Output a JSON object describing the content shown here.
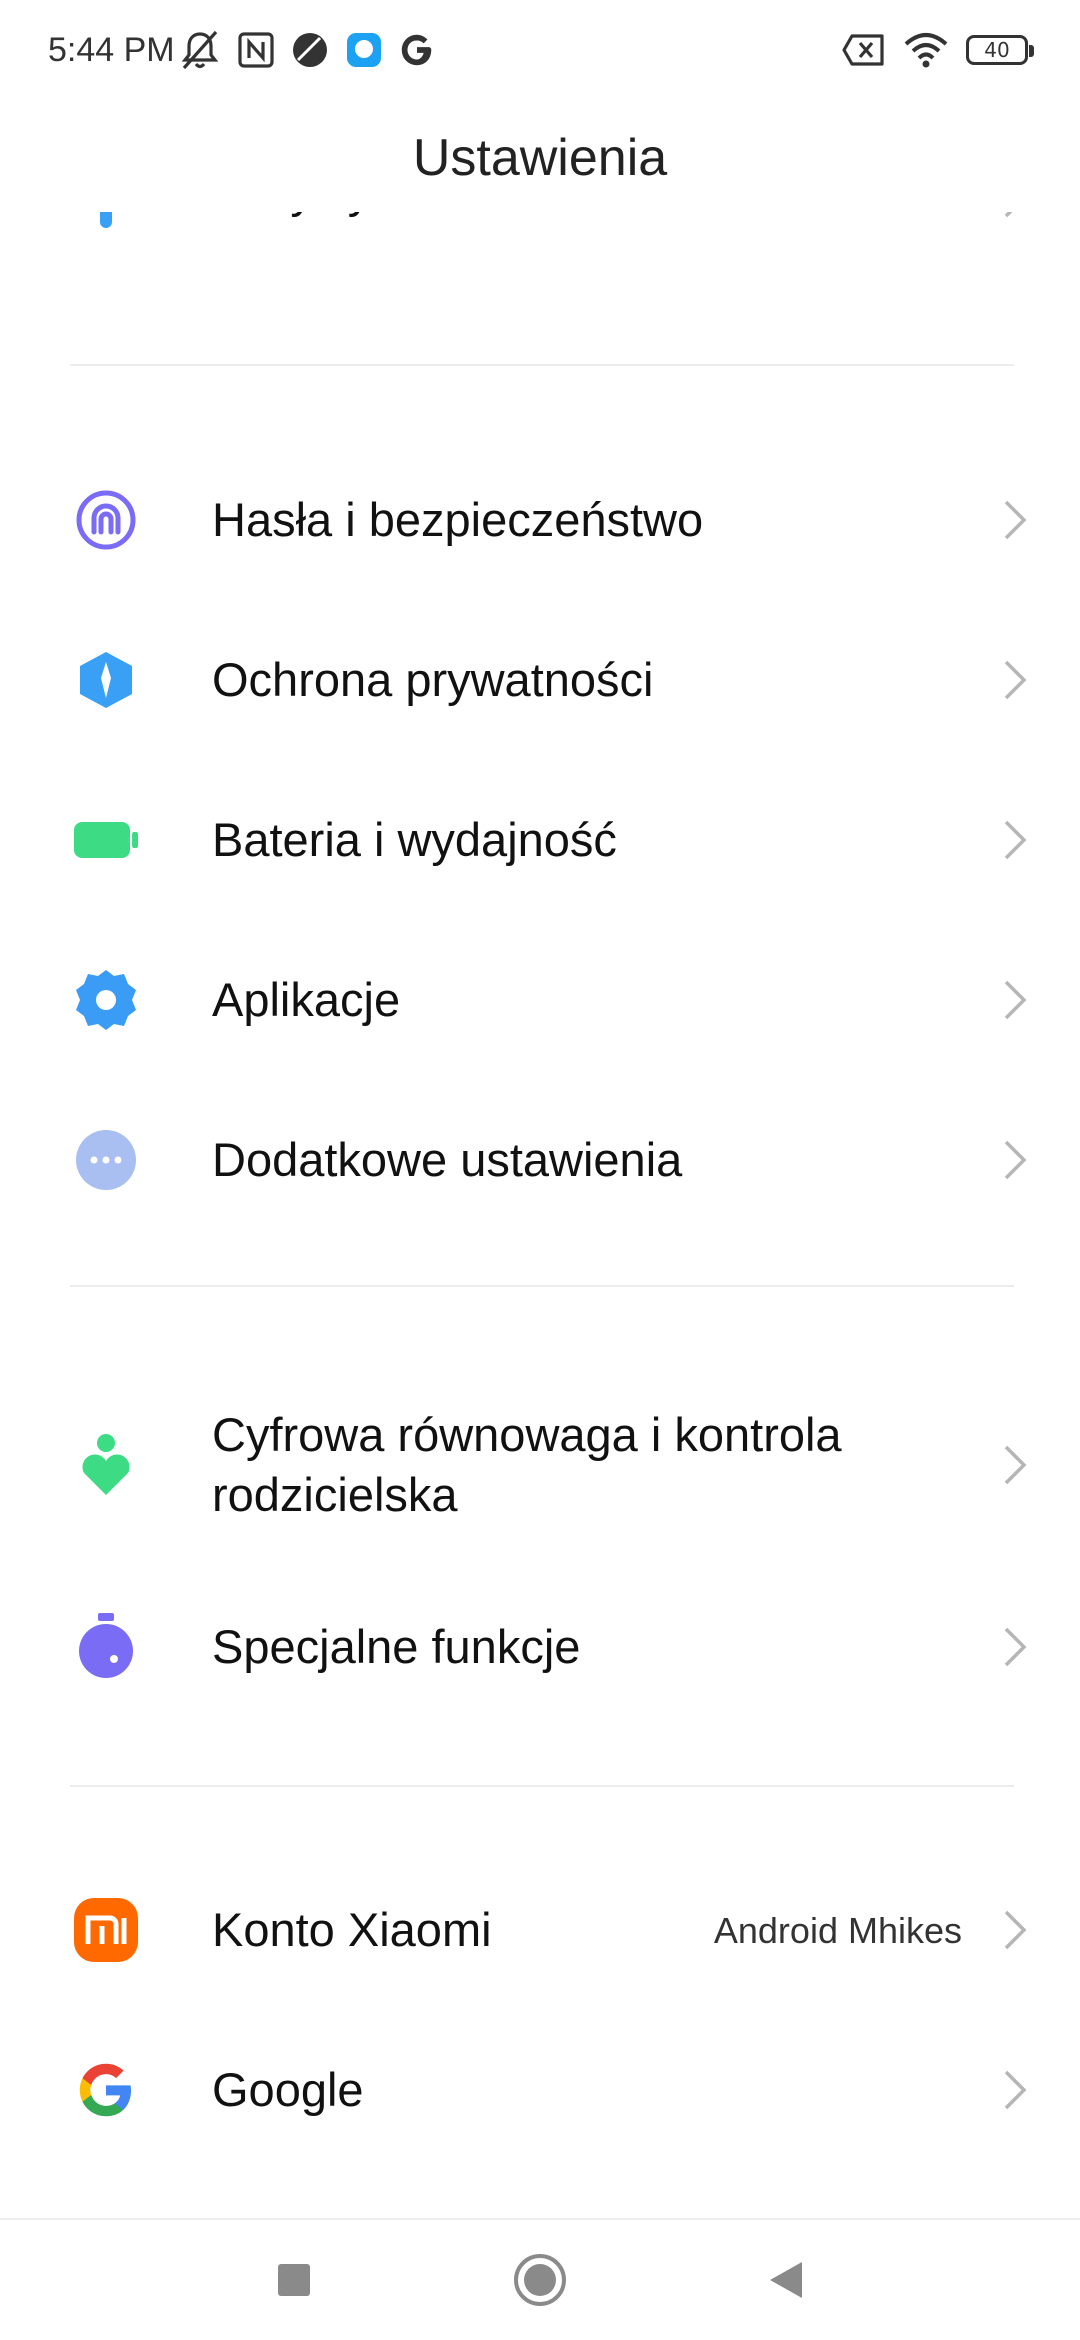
{
  "status_bar": {
    "time": "5:44 PM",
    "battery_level": "40",
    "left_icons": [
      "mute-icon",
      "nfc-icon",
      "app-icon",
      "chat-icon",
      "google-icon"
    ],
    "right_icons": [
      "no-sim-icon",
      "wifi-icon",
      "battery-icon"
    ]
  },
  "header": {
    "title": "Ustawienia"
  },
  "settings": {
    "partial_top": {
      "label": "Motywy",
      "icon": "theme-icon"
    },
    "items": [
      {
        "label": "Hasła i bezpieczeństwo",
        "icon": "fingerprint-icon",
        "color": "#7b6cf6"
      },
      {
        "label": "Ochrona prywatności",
        "icon": "privacy-shield-icon",
        "color": "#3aa0f5"
      },
      {
        "label": "Bateria i wydajność",
        "icon": "battery-performance-icon",
        "color": "#3ddc84"
      },
      {
        "label": "Aplikacje",
        "icon": "apps-gear-icon",
        "color": "#3a9cf5"
      },
      {
        "label": "Dodatkowe ustawienia",
        "icon": "more-dots-icon",
        "color": "#a9bff2"
      },
      {
        "label_line1": "Cyfrowa równowaga i kontrola",
        "label_line2": "rodzicielska",
        "icon": "wellbeing-icon",
        "color": "#3ddc84"
      },
      {
        "label": "Specjalne funkcje",
        "icon": "special-features-icon",
        "color": "#7b6cf6"
      },
      {
        "label": "Konto Xiaomi",
        "value": "Android Mhikes",
        "icon": "xiaomi-logo-icon",
        "color": "#ff6900"
      },
      {
        "label": "Google",
        "icon": "google-icon"
      }
    ]
  },
  "nav": {
    "buttons": [
      "recents-icon",
      "home-icon",
      "back-icon"
    ]
  }
}
